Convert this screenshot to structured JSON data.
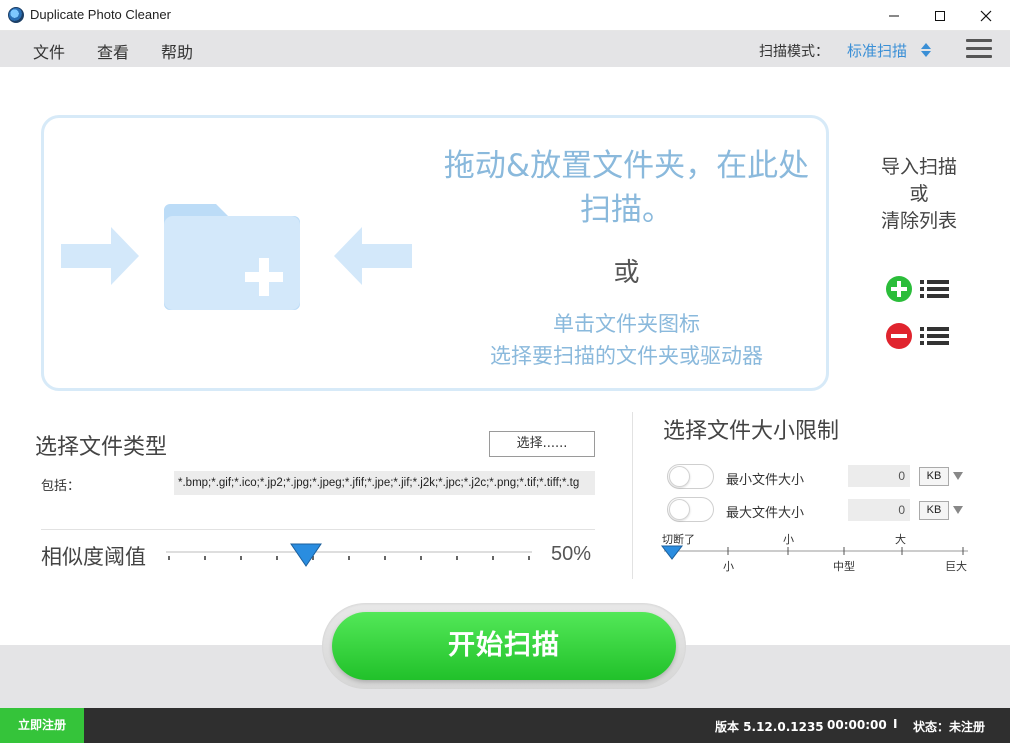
{
  "window": {
    "title": "Duplicate Photo Cleaner",
    "icon": "app-icon"
  },
  "menu": {
    "items": [
      "文件",
      "查看",
      "帮助"
    ],
    "scan_mode_label": "扫描模式：",
    "scan_mode_value": "标准扫描"
  },
  "dropzone": {
    "title": "拖动&放置文件夹，在此处扫描。",
    "or": "或",
    "hint_line1": "单击文件夹图标",
    "hint_line2": "选择要扫描的文件夹或驱动器"
  },
  "side": {
    "line1": "导入扫描",
    "line2": "或",
    "line3": "清除列表"
  },
  "file_types": {
    "heading": "选择文件类型",
    "select_button": "选择......",
    "include_label": "包括：",
    "include_value": "*.bmp;*.gif;*.ico;*.jp2;*.jpg;*.jpeg;*.jfif;*.jpe;*.jif;*.j2k;*.jpc;*.j2c;*.png;*.tif;*.tiff;*.tg"
  },
  "similarity": {
    "label": "相似度阈值",
    "value_text": "50%",
    "value": 0.5
  },
  "size_limit": {
    "heading": "选择文件大小限制",
    "min_label": "最小文件大小",
    "max_label": "最大文件大小",
    "min_value": "0",
    "max_value": "0",
    "min_unit": "KB",
    "max_unit": "KB",
    "min_enabled": false,
    "max_enabled": false,
    "scale_top": [
      "切断了",
      "小",
      "大"
    ],
    "scale_bottom": [
      "小",
      "中型",
      "巨大"
    ]
  },
  "start_button": "开始扫描",
  "statusbar": {
    "register": "立即注册",
    "version": "版本 5.12.0.1235",
    "time": "00:00:00",
    "separator": "I",
    "status": "状态：未注册"
  },
  "colors": {
    "accent_blue": "#3a8fd6",
    "drop_text": "#8ab9dc",
    "start_green": "#21c12a",
    "register_green": "#35c43a",
    "status_dark": "#2f2f2f"
  }
}
